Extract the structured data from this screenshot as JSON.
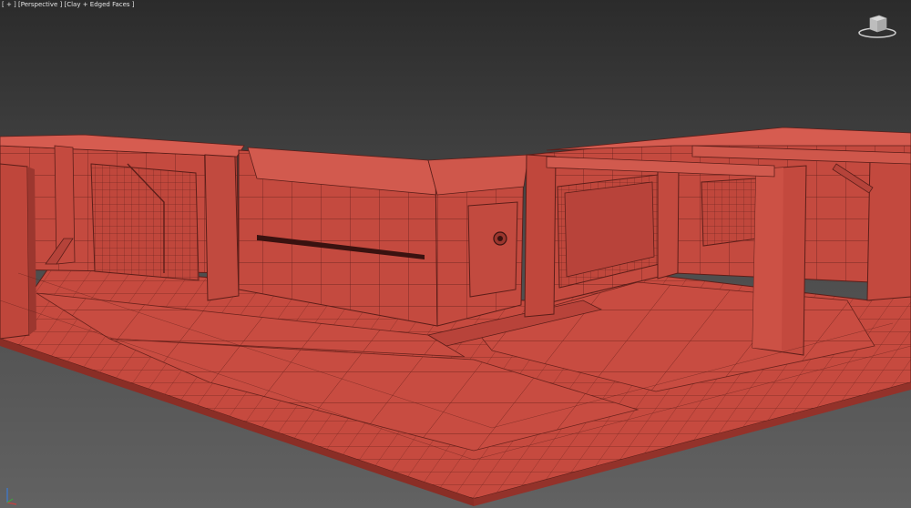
{
  "viewport": {
    "menu_label": "[ + ]",
    "view_label": "[Perspective ]",
    "shading_label": "[Clay + Edged Faces ]"
  },
  "colors": {
    "background_top": "#2b2b2b",
    "background_bottom": "#626262",
    "clay": "#c64a3f",
    "clay_dark": "#a53a31",
    "clay_light": "#d05a4e",
    "edge": "#5c1e19"
  },
  "icons": {
    "viewcube": "viewcube-icon",
    "axis": "axis-tripod-icon"
  }
}
